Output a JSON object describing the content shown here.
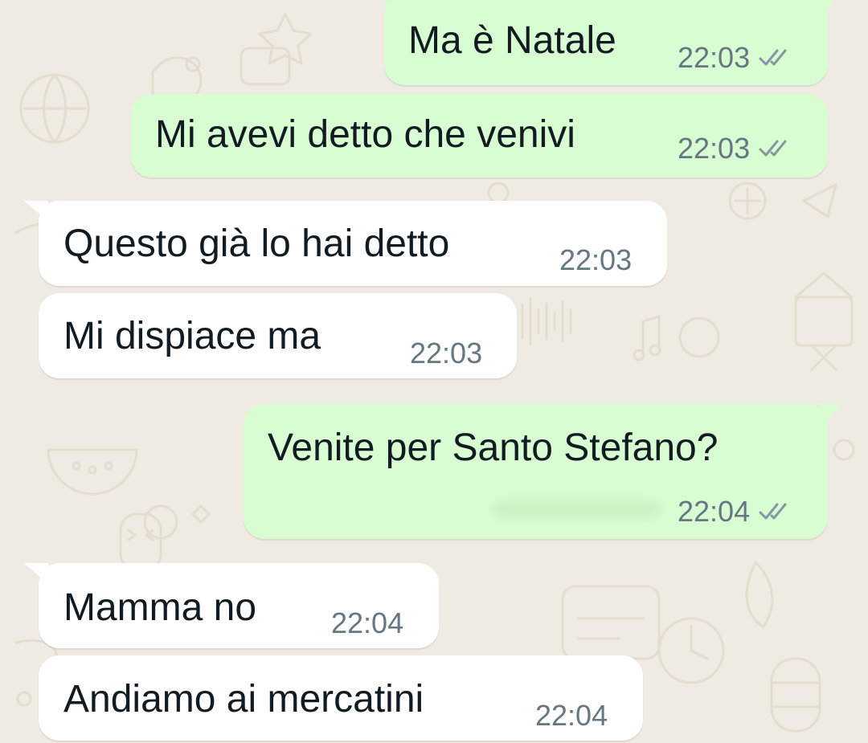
{
  "chat": {
    "messages": [
      {
        "direction": "out",
        "text": "Ma è Natale",
        "time": "22:03",
        "status": "read"
      },
      {
        "direction": "out",
        "text": "Mi avevi detto che venivi",
        "time": "22:03",
        "status": "read"
      },
      {
        "direction": "in",
        "text": "Questo già lo hai detto",
        "time": "22:03"
      },
      {
        "direction": "in",
        "text": "Mi dispiace ma",
        "time": "22:03"
      },
      {
        "direction": "out",
        "text": "Venite per Santo Stefano?",
        "time": "22:04",
        "status": "read"
      },
      {
        "direction": "in",
        "text": "Mamma no",
        "time": "22:04"
      },
      {
        "direction": "in",
        "text": "Andiamo ai mercatini",
        "time": "22:04"
      }
    ]
  },
  "colors": {
    "background": "#efeae2",
    "incoming_bubble": "#ffffff",
    "outgoing_bubble": "#d9fdd3",
    "text": "#111b21",
    "time": "#667781",
    "read_ticks": "#8696a0"
  },
  "icons": {
    "read_receipt": "double-check-icon"
  }
}
